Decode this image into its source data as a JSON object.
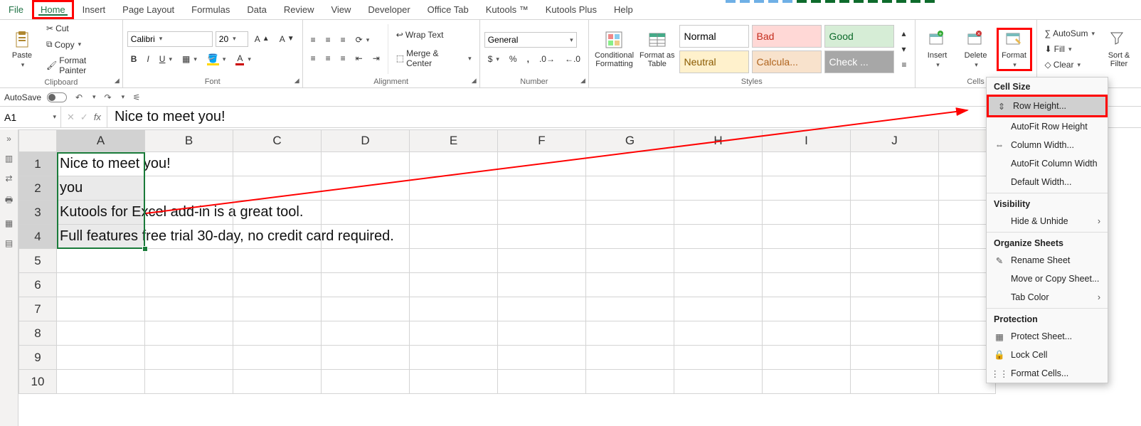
{
  "tabs": {
    "file": "File",
    "home": "Home",
    "insert": "Insert",
    "page": "Page Layout",
    "formulas": "Formulas",
    "data": "Data",
    "review": "Review",
    "view": "View",
    "developer": "Developer",
    "officetab": "Office Tab",
    "kutools": "Kutools ™",
    "kutoolsplus": "Kutools Plus",
    "help": "Help"
  },
  "clipboard": {
    "cut": "Cut",
    "copy": "Copy",
    "painter": "Format Painter",
    "paste": "Paste",
    "label": "Clipboard"
  },
  "font": {
    "name": "Calibri",
    "size": "20",
    "label": "Font"
  },
  "alignment": {
    "wrap": "Wrap Text",
    "merge": "Merge & Center",
    "label": "Alignment"
  },
  "numbergrp": {
    "format": "General",
    "label": "Number"
  },
  "styles": {
    "cf": "Conditional\nFormatting",
    "fat": "Format as\nTable",
    "s1": "Normal",
    "s2": "Bad",
    "s3": "Good",
    "s4": "Neutral",
    "s5": "Calcula...",
    "s6": "Check ...",
    "label": "Styles"
  },
  "cellsgrp": {
    "insert": "Insert",
    "delete": "Delete",
    "format": "Format",
    "label": "Cells"
  },
  "editing": {
    "sum": "AutoSum",
    "fill": "Fill",
    "clear": "Clear",
    "sort": "Sort &\nFilter"
  },
  "quick": {
    "autosave": "AutoSave"
  },
  "namebox": "A1",
  "formula": "Nice to meet you!",
  "columns": [
    "A",
    "B",
    "C",
    "D",
    "E",
    "F",
    "G",
    "H",
    "I",
    "J"
  ],
  "rows": [
    "1",
    "2",
    "3",
    "4",
    "5",
    "6",
    "7",
    "8",
    "9",
    "10"
  ],
  "celldata": {
    "r1": "Nice to meet you!",
    "r2": "you",
    "r3": "Kutools for Excel add-in is a great tool.",
    "r4": "Full features free trial 30-day, no credit card required."
  },
  "menu": {
    "hdr1": "Cell Size",
    "rowh": "Row Height...",
    "arow": "AutoFit Row Height",
    "colw": "Column Width...",
    "acolw": "AutoFit Column Width",
    "defw": "Default Width...",
    "hdr2": "Visibility",
    "hide": "Hide & Unhide",
    "hdr3": "Organize Sheets",
    "ren": "Rename Sheet",
    "move": "Move or Copy Sheet...",
    "tabc": "Tab Color",
    "hdr4": "Protection",
    "prot": "Protect Sheet...",
    "lock": "Lock Cell",
    "fmtc": "Format Cells..."
  }
}
